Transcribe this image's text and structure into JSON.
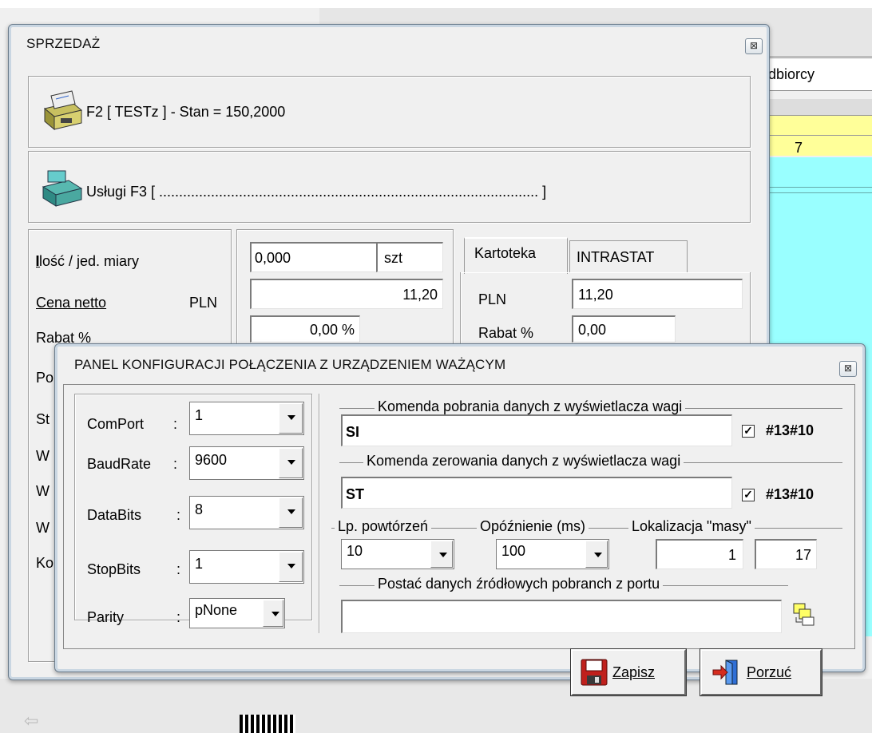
{
  "background": {
    "top_input_label": "dbiorcy",
    "yellow_row_value": "7"
  },
  "sale_window": {
    "title": "SPRZEDAŻ",
    "close_glyph": "⊠",
    "f2_line": "F2 [ TESTz ] - Stan = 150,2000",
    "f3_line": "Usługi  F3 [ ............................................................................................... ]",
    "labels": {
      "quantity": "Ilość / jed. miary",
      "net_price": "Cena netto",
      "net_price_currency": "PLN",
      "discount": "Rabat %",
      "row4": "Po",
      "row5": "St",
      "row6": "W",
      "row7": "W",
      "row8": "W",
      "row9": "Ko"
    },
    "fields": {
      "quantity": "0,000",
      "unit": "szt",
      "net_price": "11,20",
      "discount": "0,00 %"
    },
    "tabs": [
      "Kartoteka",
      "INTRASTAT"
    ],
    "card": {
      "currency_label": "PLN",
      "price": "11,20",
      "discount_label": "Rabat %",
      "discount": "0,00"
    }
  },
  "scale_panel": {
    "title": "PANEL KONFIGURACJI POŁĄCZENIA Z URZĄDZENIEM WAŻĄCYM",
    "close_glyph": "⊠",
    "port": {
      "comport_label": "ComPort",
      "comport_value": "1",
      "baud_label": "BaudRate",
      "baud_value": "9600",
      "databits_label": "DataBits",
      "databits_value": "8",
      "stopbits_label": "StopBits",
      "stopbits_value": "1",
      "parity_label": "Parity",
      "parity_value": "pNone",
      "colon": ":"
    },
    "read_cmd": {
      "legend": "Komenda pobrania danych z wyświetlacza wagi",
      "value": "SI",
      "checkbox_label": "#13#10",
      "checked": true
    },
    "zero_cmd": {
      "legend": "Komenda zerowania danych z wyświetlacza wagi",
      "value": "ST",
      "checkbox_label": "#13#10",
      "checked": true
    },
    "repeats": {
      "legend": "Lp. powtórzeń",
      "value": "10"
    },
    "delay": {
      "legend": "Opóźnienie (ms)",
      "value": "100"
    },
    "mass_location": {
      "legend": "Lokalizacja \"masy\"",
      "from": "1",
      "to": "17"
    },
    "raw_data": {
      "legend": "Postać danych źródłowych pobranch z portu",
      "value": ""
    },
    "buttons": {
      "save": "Zapisz",
      "cancel": "Porzuć"
    }
  },
  "colors": {
    "window_bg": "#f0f0f0",
    "frame": "#c9d6e2",
    "yellow": "#ffff99",
    "cyan": "#99ffff"
  }
}
